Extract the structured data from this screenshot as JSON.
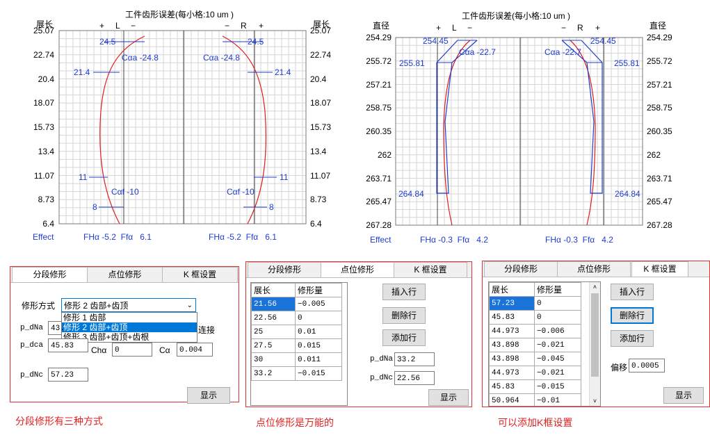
{
  "colors": {
    "accent": "#1f3ccf",
    "curve": "#e01b1b",
    "caption": "#e02020",
    "selection": "#1a73d9"
  },
  "left_chart": {
    "title": "工件齿形误差(每小格:10 um )",
    "axis_label_left": "展长",
    "axis_label_right": "展长",
    "left_signs": {
      "plus": "+",
      "flank": "L",
      "minus": "−"
    },
    "right_signs": {
      "minus": "−",
      "flank": "R",
      "plus": "+"
    },
    "ticks": [
      "25.07",
      "22.74",
      "20.4",
      "18.07",
      "15.73",
      "13.4",
      "11.07",
      "8.73",
      "6.4"
    ],
    "labels": {
      "l_24_5": "24.5",
      "l_ca": "Cαa -24.8",
      "l_21_4": "21.4",
      "l_11": "11",
      "l_cf": "Cαf -10",
      "l_8": "8",
      "r_24_5": "24.5",
      "r_ca": "Cαa -24.8",
      "r_21_4": "21.4",
      "r_11": "11",
      "r_cf": "Cαf -10",
      "r_8": "8"
    },
    "effect": "Effect",
    "left_stats": "FHα -5.2  Ffα   6.1",
    "right_stats": "FHα -5.2  Ffα   6.1"
  },
  "right_chart": {
    "title": "工件齿形误差(每小格:10 um )",
    "axis_label_left": "直径",
    "axis_label_right": "直径",
    "left_signs": {
      "plus": "+",
      "flank": "L",
      "minus": "−"
    },
    "right_signs": {
      "minus": "−",
      "flank": "R",
      "plus": "+"
    },
    "ticks": [
      "254.29",
      "255.72",
      "257.21",
      "258.75",
      "260.35",
      "262",
      "263.71",
      "265.47",
      "267.28"
    ],
    "labels": {
      "l_254": "254.45",
      "l_ca": "Cαa -22.7",
      "l_255": "255.81",
      "l_264": "264.84",
      "r_254": "254.45",
      "r_ca": "Cαa -22.7",
      "r_255": "255.81",
      "r_264": "264.84"
    },
    "effect": "Effect",
    "left_stats": "FHα -0.3  Ffα   4.2",
    "right_stats": "FHα -0.3  Ffα   4.2"
  },
  "panel1": {
    "tabs": [
      "分段修形",
      "点位修形",
      "K 框设置"
    ],
    "mode_label": "修形方式",
    "mode_selected": "修形 2  齿部+齿顶",
    "options": [
      "修形 1  齿部",
      "修形 2  齿部+齿顶",
      "修形 3  齿部+齿顶+齿根"
    ],
    "p_dNa_label": "p_dNa",
    "p_dNa_value": "43.",
    "p_dca_label": "p_dca",
    "p_dca_value": "45.83",
    "partial_text": "连接",
    "ch_label": "Chα",
    "ch_value": "0",
    "ca_label": "Cα",
    "ca_value": "0.004",
    "p_dNc_label": "p_dNc",
    "p_dNc_value": "57.23",
    "show_button": "显示"
  },
  "panel2": {
    "tabs": [
      "分段修形",
      "点位修形",
      "K 框设置"
    ],
    "headers": [
      "展长",
      "修形量"
    ],
    "rows": [
      [
        "21.56",
        "−0.005"
      ],
      [
        "22.56",
        "0"
      ],
      [
        "25",
        "0.01"
      ],
      [
        "27.5",
        "0.015"
      ],
      [
        "30",
        "0.011"
      ],
      [
        "33.2",
        "−0.015"
      ]
    ],
    "insert_button": "插入行",
    "delete_button": "删除行",
    "add_button": "添加行",
    "p_dNa_label": "p_dNa",
    "p_dNa_value": "33.2",
    "p_dNc_label": "p_dNc",
    "p_dNc_value": "22.56",
    "show_button": "显示"
  },
  "panel3": {
    "tabs": [
      "分段修形",
      "点位修形",
      "K 框设置"
    ],
    "headers": [
      "展长",
      "修形量"
    ],
    "rows": [
      [
        "57.23",
        "0"
      ],
      [
        "45.83",
        "0"
      ],
      [
        "44.973",
        "−0.006"
      ],
      [
        "43.898",
        "−0.021"
      ],
      [
        "43.898",
        "−0.045"
      ],
      [
        "44.973",
        "−0.021"
      ],
      [
        "45.83",
        "−0.015"
      ],
      [
        "50.964",
        "−0.01"
      ]
    ],
    "insert_button": "插入行",
    "delete_button": "删除行",
    "add_button": "添加行",
    "offset_label": "偏移",
    "offset_value": "0.0005",
    "show_button": "显示"
  },
  "captions": {
    "c1": "分段修形有三种方式",
    "c2": "点位修形是万能的",
    "c3": "可以添加K框设置"
  }
}
